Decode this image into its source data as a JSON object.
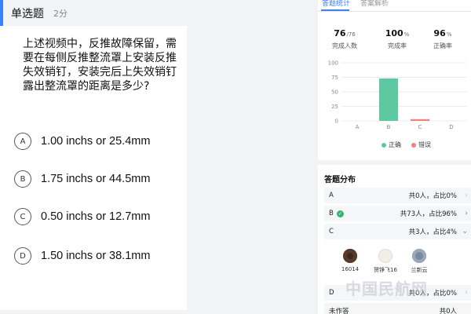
{
  "question": {
    "type_label": "单选题",
    "score_label": "2分",
    "text": "上述视频中，反推故障保留，需要在每侧反推整流罩上安装反推失效销钉，安装完后上失效销钉露出整流罩的距离是多少?",
    "options": [
      {
        "letter": "A",
        "text": "1.00 inchs or 25.4mm"
      },
      {
        "letter": "B",
        "text": "1.75 inchs or 44.5mm"
      },
      {
        "letter": "C",
        "text": "0.50 inchs or 12.7mm"
      },
      {
        "letter": "D",
        "text": "1.50 inchs or 38.1mm"
      }
    ]
  },
  "tabs": {
    "stats": "答题统计",
    "analysis": "答案解析"
  },
  "stats": {
    "completed": {
      "value": "76",
      "unit": "/76",
      "label": "完成人数"
    },
    "completion_rate": {
      "value": "100",
      "unit": "%",
      "label": "完成率"
    },
    "accuracy": {
      "value": "96",
      "unit": "%",
      "label": "正确率"
    }
  },
  "chart_data": {
    "type": "bar",
    "categories": [
      "A",
      "B",
      "C",
      "D"
    ],
    "series": [
      {
        "name": "正确",
        "values": [
          0,
          73,
          0,
          0
        ],
        "color": "#5cc9a1"
      },
      {
        "name": "错误",
        "values": [
          0,
          0,
          3,
          0
        ],
        "color": "#f08080"
      }
    ],
    "ylim": [
      0,
      100
    ],
    "yticks": [
      "0",
      "25",
      "50",
      "75",
      "100"
    ],
    "legend": "bottom"
  },
  "distribution": {
    "title": "答题分布",
    "rows": [
      {
        "letter": "A",
        "info": "共0人，占比0%",
        "correct": false,
        "expanded": false
      },
      {
        "letter": "B",
        "info": "共73人，占比96%",
        "correct": true,
        "expanded": false
      },
      {
        "letter": "C",
        "info": "共3人，占比4%",
        "correct": false,
        "expanded": true
      },
      {
        "letter": "D",
        "info": "共0人，占比0%",
        "correct": false,
        "expanded": false
      }
    ],
    "unanswered": {
      "label": "未作答",
      "info": "共0人"
    },
    "c_respondents": [
      {
        "name": "16014",
        "avatar_color": "#3a2a20"
      },
      {
        "name": "贺铮飞16",
        "avatar_color": "#f0eee6"
      },
      {
        "name": "兰新云",
        "avatar_color": "#7a8aa0"
      }
    ]
  },
  "watermark": "中国民航网"
}
